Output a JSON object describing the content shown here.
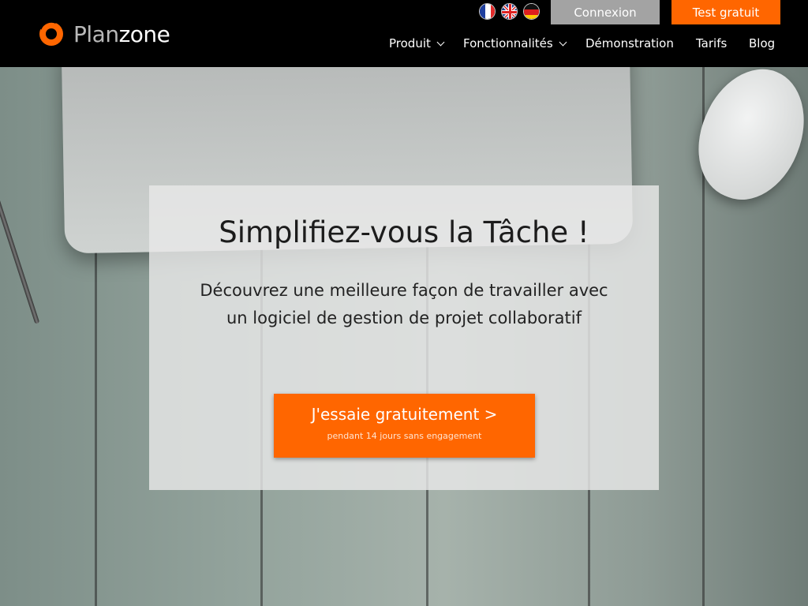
{
  "header": {
    "logo": {
      "text_part1": "Plan",
      "text_part2": "zone"
    },
    "languages": [
      {
        "code": "fr",
        "icon": "flag-france-icon"
      },
      {
        "code": "en",
        "icon": "flag-uk-icon"
      },
      {
        "code": "de",
        "icon": "flag-germany-icon"
      }
    ],
    "login_label": "Connexion",
    "trial_label": "Test gratuit",
    "nav": [
      {
        "label": "Produit",
        "dropdown": true
      },
      {
        "label": "Fonctionnalités",
        "dropdown": true
      },
      {
        "label": "Démonstration",
        "dropdown": false
      },
      {
        "label": "Tarifs",
        "dropdown": false
      },
      {
        "label": "Blog",
        "dropdown": false
      }
    ]
  },
  "hero": {
    "title": "Simplifiez-vous la Tâche !",
    "subtitle_line1": "Découvrez une meilleure façon de travailler avec",
    "subtitle_line2": "un logiciel de gestion de projet collaboratif",
    "cta_label": "J'essaie gratuitement >",
    "cta_note": "pendant 14 jours sans engagement"
  },
  "colors": {
    "accent": "#ff6600",
    "header_bg": "#000000",
    "login_bg": "#a3a3a3"
  }
}
